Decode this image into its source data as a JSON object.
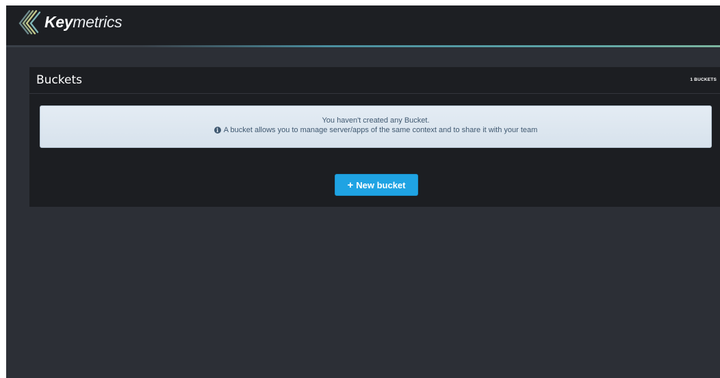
{
  "brand": {
    "name_bold": "Key",
    "name_rest": "metrics",
    "logo_icon": "chevron-stripes-logo"
  },
  "buckets_panel": {
    "title": "Buckets",
    "count_number": "1",
    "count_label": "BUCKETS",
    "empty_message": "You haven't created any Bucket.",
    "info_text": "A bucket allows you to manage server/apps of the same context and to share it with your team",
    "info_icon": "info-circle-icon",
    "new_button_label": "New bucket",
    "new_button_icon": "plus-icon"
  },
  "colors": {
    "topbar": "#1d1f23",
    "background": "#2c2f36",
    "panel": "#1c1e22",
    "accent_button": "#1fa3e3",
    "alert_background": "#dfe8f1",
    "alert_text": "#3f5870"
  }
}
